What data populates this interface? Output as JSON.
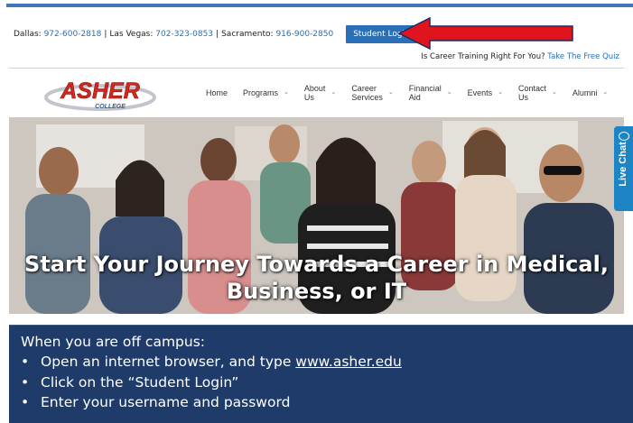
{
  "topbar": {
    "dallas_label": "Dallas:",
    "dallas_phone": "972-600-2818",
    "vegas_label": "Las Vegas:",
    "vegas_phone": "702-323-0853",
    "sacramento_label": "Sacramento:",
    "sacramento_phone": "916-900-2850",
    "separator": "|",
    "student_login": "Student Login"
  },
  "quiz": {
    "prompt": "Is Career Training Right For You?",
    "link": "Take The Free Quiz"
  },
  "logo": {
    "name": "ASHER",
    "sub": "COLLEGE"
  },
  "nav": {
    "home": "Home",
    "programs": "Programs",
    "about_1": "About",
    "about_2": "Us",
    "career_1": "Career",
    "career_2": "Services",
    "financial_1": "Financial",
    "financial_2": "Aid",
    "events": "Events",
    "contact_1": "Contact",
    "contact_2": "Us",
    "alumni": "Alumni",
    "chevron": "⌄"
  },
  "hero": {
    "line1": "Start Your Journey Towards a Career in Medical,",
    "line2": "Business, or IT"
  },
  "livechat": {
    "label": "Live Chat"
  },
  "instructions": {
    "heading": "When you are off campus:",
    "bullet": "•",
    "step1_prefix": "Open an internet browser, and type ",
    "step1_link": "www.asher.edu",
    "step2": "Click on the “Student Login”",
    "step3": "Enter your username and password"
  },
  "colors": {
    "brand_blue": "#2b6fb6",
    "arrow_red": "#e0141c",
    "instructions_bg": "#1f3b6a",
    "livechat_bg": "#1d84c6"
  }
}
